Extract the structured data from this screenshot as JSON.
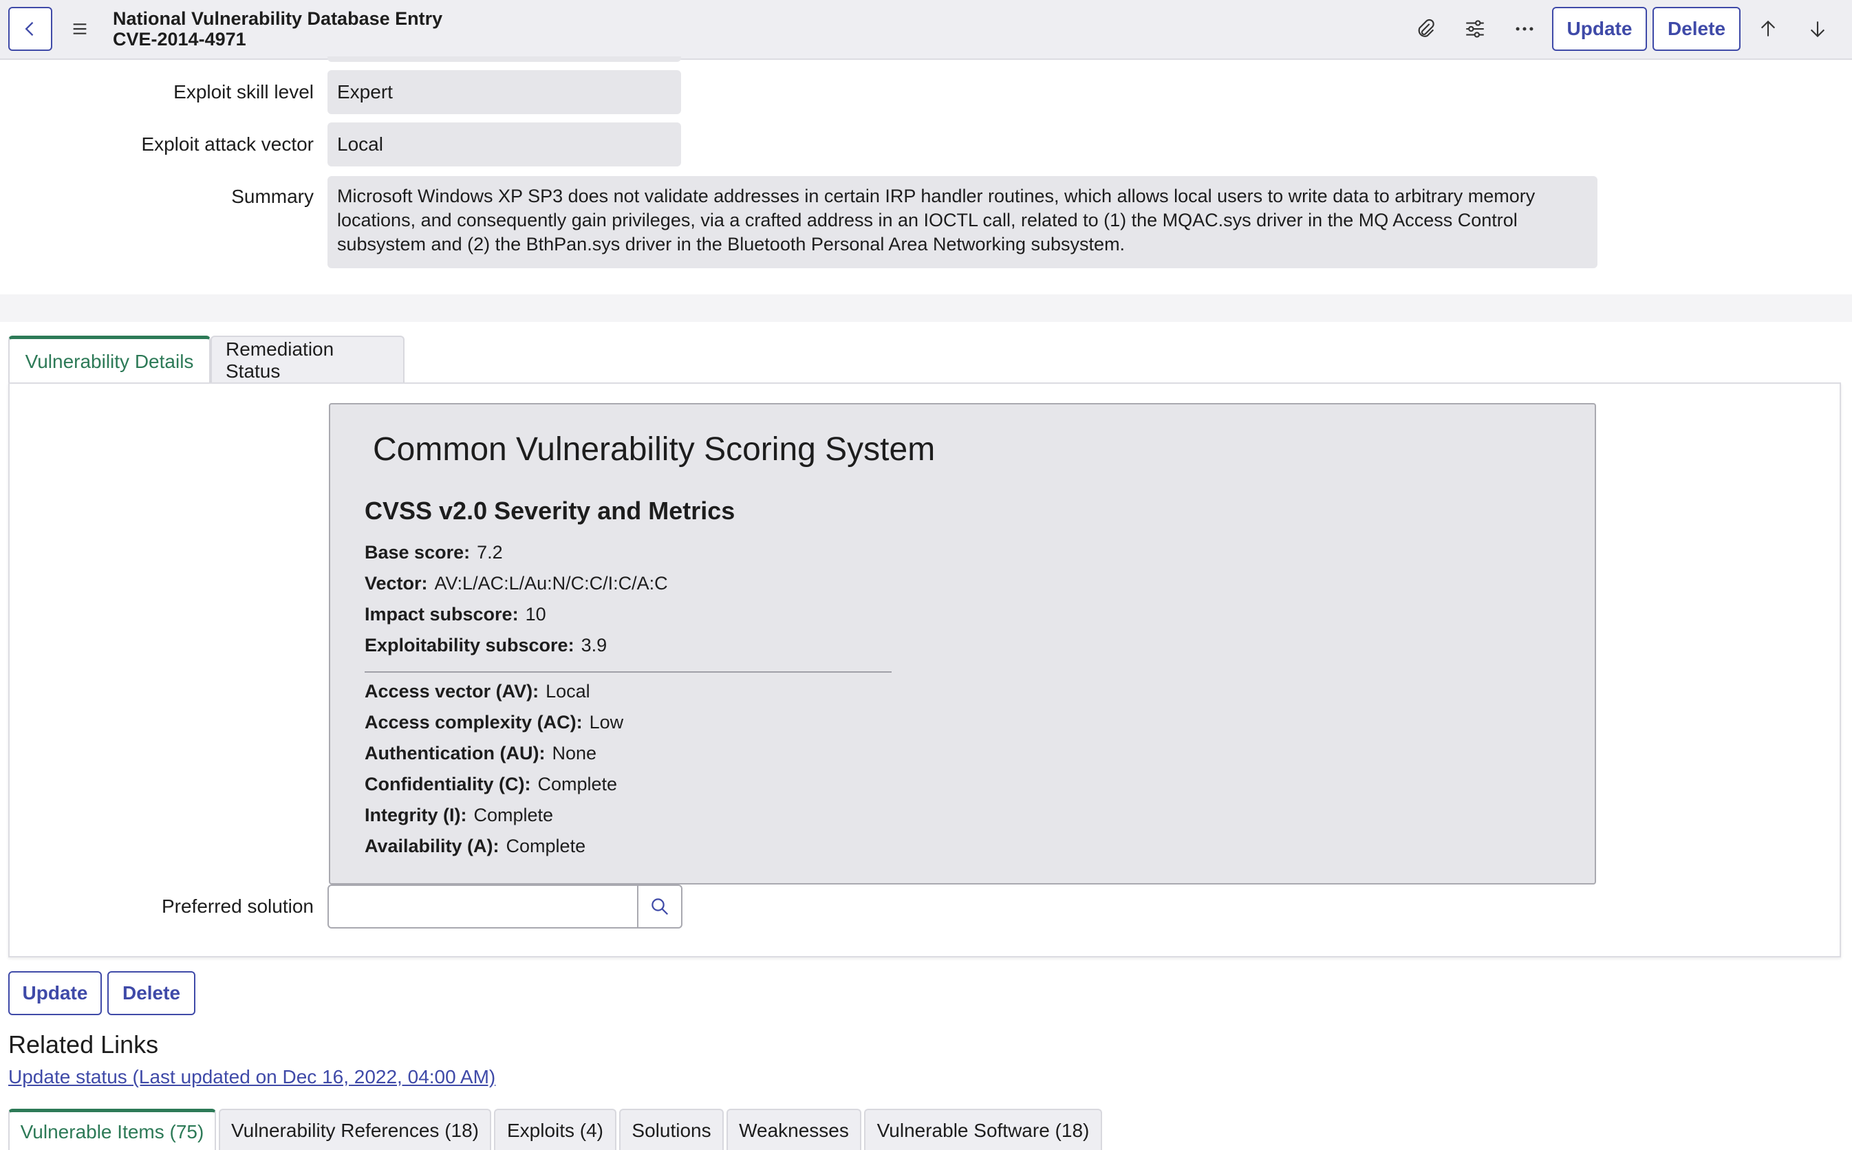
{
  "header": {
    "title_line1": "National Vulnerability Database Entry",
    "title_line2": "CVE-2014-4971",
    "update_label": "Update",
    "delete_label": "Delete"
  },
  "fields": {
    "exploit_skill_label": "Exploit skill level",
    "exploit_skill_value": "Expert",
    "exploit_vector_label": "Exploit attack vector",
    "exploit_vector_value": "Local",
    "summary_label": "Summary",
    "summary_value": "Microsoft Windows XP SP3 does not validate addresses in certain IRP handler routines, which allows local users to write data to arbitrary memory locations, and consequently gain privileges, via a crafted address in an IOCTL call, related to (1) the MQAC.sys driver in the MQ Access Control subsystem and (2) the BthPan.sys driver in the Bluetooth Personal Area Networking subsystem."
  },
  "tabs": [
    {
      "label": "Vulnerability Details",
      "active": true
    },
    {
      "label": "Remediation Status",
      "active": false
    }
  ],
  "cvss": {
    "title": "Common Vulnerability Scoring System",
    "subtitle": "CVSS v2.0 Severity and Metrics",
    "scores": [
      {
        "label": "Base score:",
        "value": "7.2"
      },
      {
        "label": "Vector:",
        "value": "AV:L/AC:L/Au:N/C:C/I:C/A:C"
      },
      {
        "label": "Impact subscore:",
        "value": "10"
      },
      {
        "label": "Exploitability subscore:",
        "value": "3.9"
      }
    ],
    "metrics": [
      {
        "label": "Access vector (AV):",
        "value": "Local"
      },
      {
        "label": "Access complexity (AC):",
        "value": "Low"
      },
      {
        "label": "Authentication (AU):",
        "value": "None"
      },
      {
        "label": "Confidentiality (C):",
        "value": "Complete"
      },
      {
        "label": "Integrity (I):",
        "value": "Complete"
      },
      {
        "label": "Availability (A):",
        "value": "Complete"
      }
    ]
  },
  "preferred_solution": {
    "label": "Preferred solution",
    "value": ""
  },
  "footer_buttons": {
    "update_label": "Update",
    "delete_label": "Delete"
  },
  "related": {
    "title": "Related Links",
    "link_text": "Update status (Last updated on Dec 16, 2022, 04:00 AM)"
  },
  "related_tabs": [
    {
      "label": "Vulnerable Items (75)",
      "active": true
    },
    {
      "label": "Vulnerability References (18)",
      "active": false
    },
    {
      "label": "Exploits (4)",
      "active": false
    },
    {
      "label": "Solutions",
      "active": false
    },
    {
      "label": "Weaknesses",
      "active": false
    },
    {
      "label": "Vulnerable Software (18)",
      "active": false
    }
  ],
  "colors": {
    "accent": "#3f4aa8",
    "active_tab": "#2d7a57",
    "field_bg": "#e6e6ea"
  }
}
